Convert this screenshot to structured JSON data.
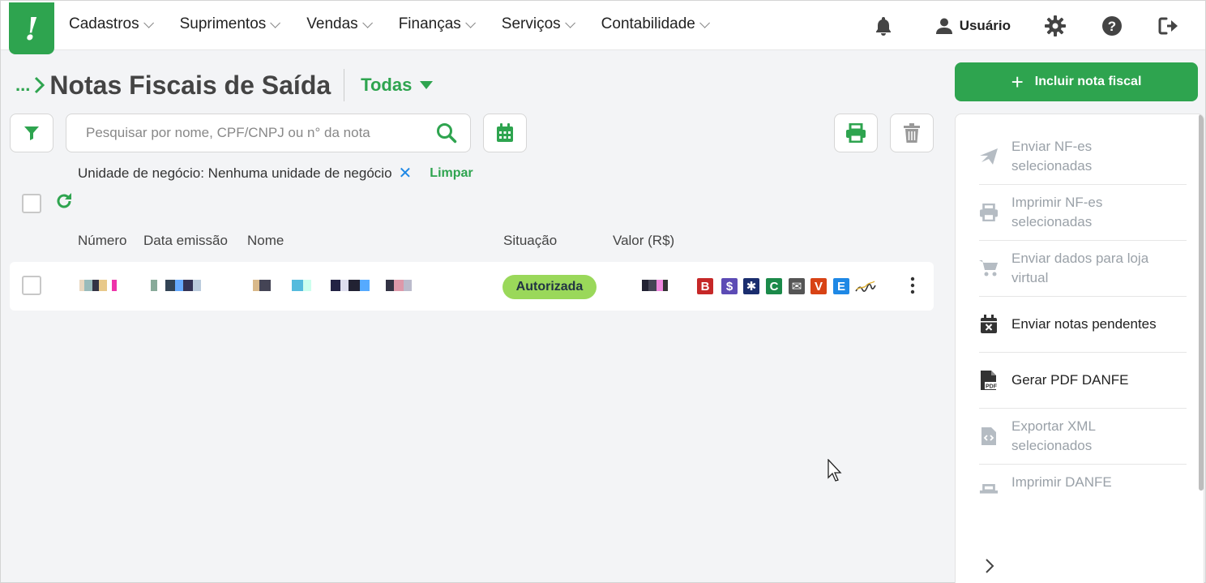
{
  "nav": {
    "logo": "!",
    "items": [
      {
        "label": "Cadastros"
      },
      {
        "label": "Suprimentos"
      },
      {
        "label": "Vendas"
      },
      {
        "label": "Finanças"
      },
      {
        "label": "Serviços"
      },
      {
        "label": "Contabilidade"
      }
    ],
    "user_label": "Usuário"
  },
  "header": {
    "breadcrumb_dots": "...",
    "title": "Notas Fiscais de Saída",
    "filter_dropdown": "Todas"
  },
  "actions": {
    "include_label": "Incluir nota fiscal"
  },
  "search": {
    "placeholder": "Pesquisar por nome, CPF/CNPJ ou n° da nota",
    "value": ""
  },
  "filter_tag": {
    "text": "Unidade de negócio: Nenhuma unidade de negócio",
    "remove": "✕",
    "clear": "Limpar"
  },
  "table": {
    "columns": [
      "Número",
      "Data emissão",
      "Nome",
      "Situação",
      "Valor (R$)"
    ],
    "rows": [
      {
        "status": "Autorizada"
      }
    ],
    "icons": [
      {
        "name": "b-icon",
        "glyph": "B",
        "color": "#c62828"
      },
      {
        "name": "dollar-icon",
        "glyph": "$",
        "color": "#5c4bb5"
      },
      {
        "name": "asterisk-tag-icon",
        "glyph": "✱",
        "color": "#1a2d6e"
      },
      {
        "name": "c-icon",
        "glyph": "C",
        "color": "#1b8a4a"
      },
      {
        "name": "envelope-icon",
        "glyph": "✉",
        "color": "#555555"
      },
      {
        "name": "v-icon",
        "glyph": "V",
        "color": "#d84315"
      },
      {
        "name": "e-icon",
        "glyph": "E",
        "color": "#1e88e5"
      }
    ]
  },
  "side_panel": {
    "items": [
      {
        "label_1": "Enviar NF-es",
        "label_2": "selecionadas",
        "enabled": false
      },
      {
        "label_1": "Imprimir NF-es",
        "label_2": "selecionadas",
        "enabled": false
      },
      {
        "label_1": "Enviar dados para loja",
        "label_2": "virtual",
        "enabled": false
      },
      {
        "label_1": "Enviar notas pendentes",
        "label_2": "",
        "enabled": true
      },
      {
        "label_1": "Gerar PDF DANFE",
        "label_2": "",
        "enabled": true
      },
      {
        "label_1": "Exportar XML",
        "label_2": "selecionados",
        "enabled": false
      },
      {
        "label_1": "Imprimir DANFE",
        "label_2": "",
        "enabled": false
      }
    ]
  },
  "colors": {
    "brand": "#2ea44f",
    "status_authorized": "#9ad85a",
    "disabled_text": "#9aa1a8"
  }
}
